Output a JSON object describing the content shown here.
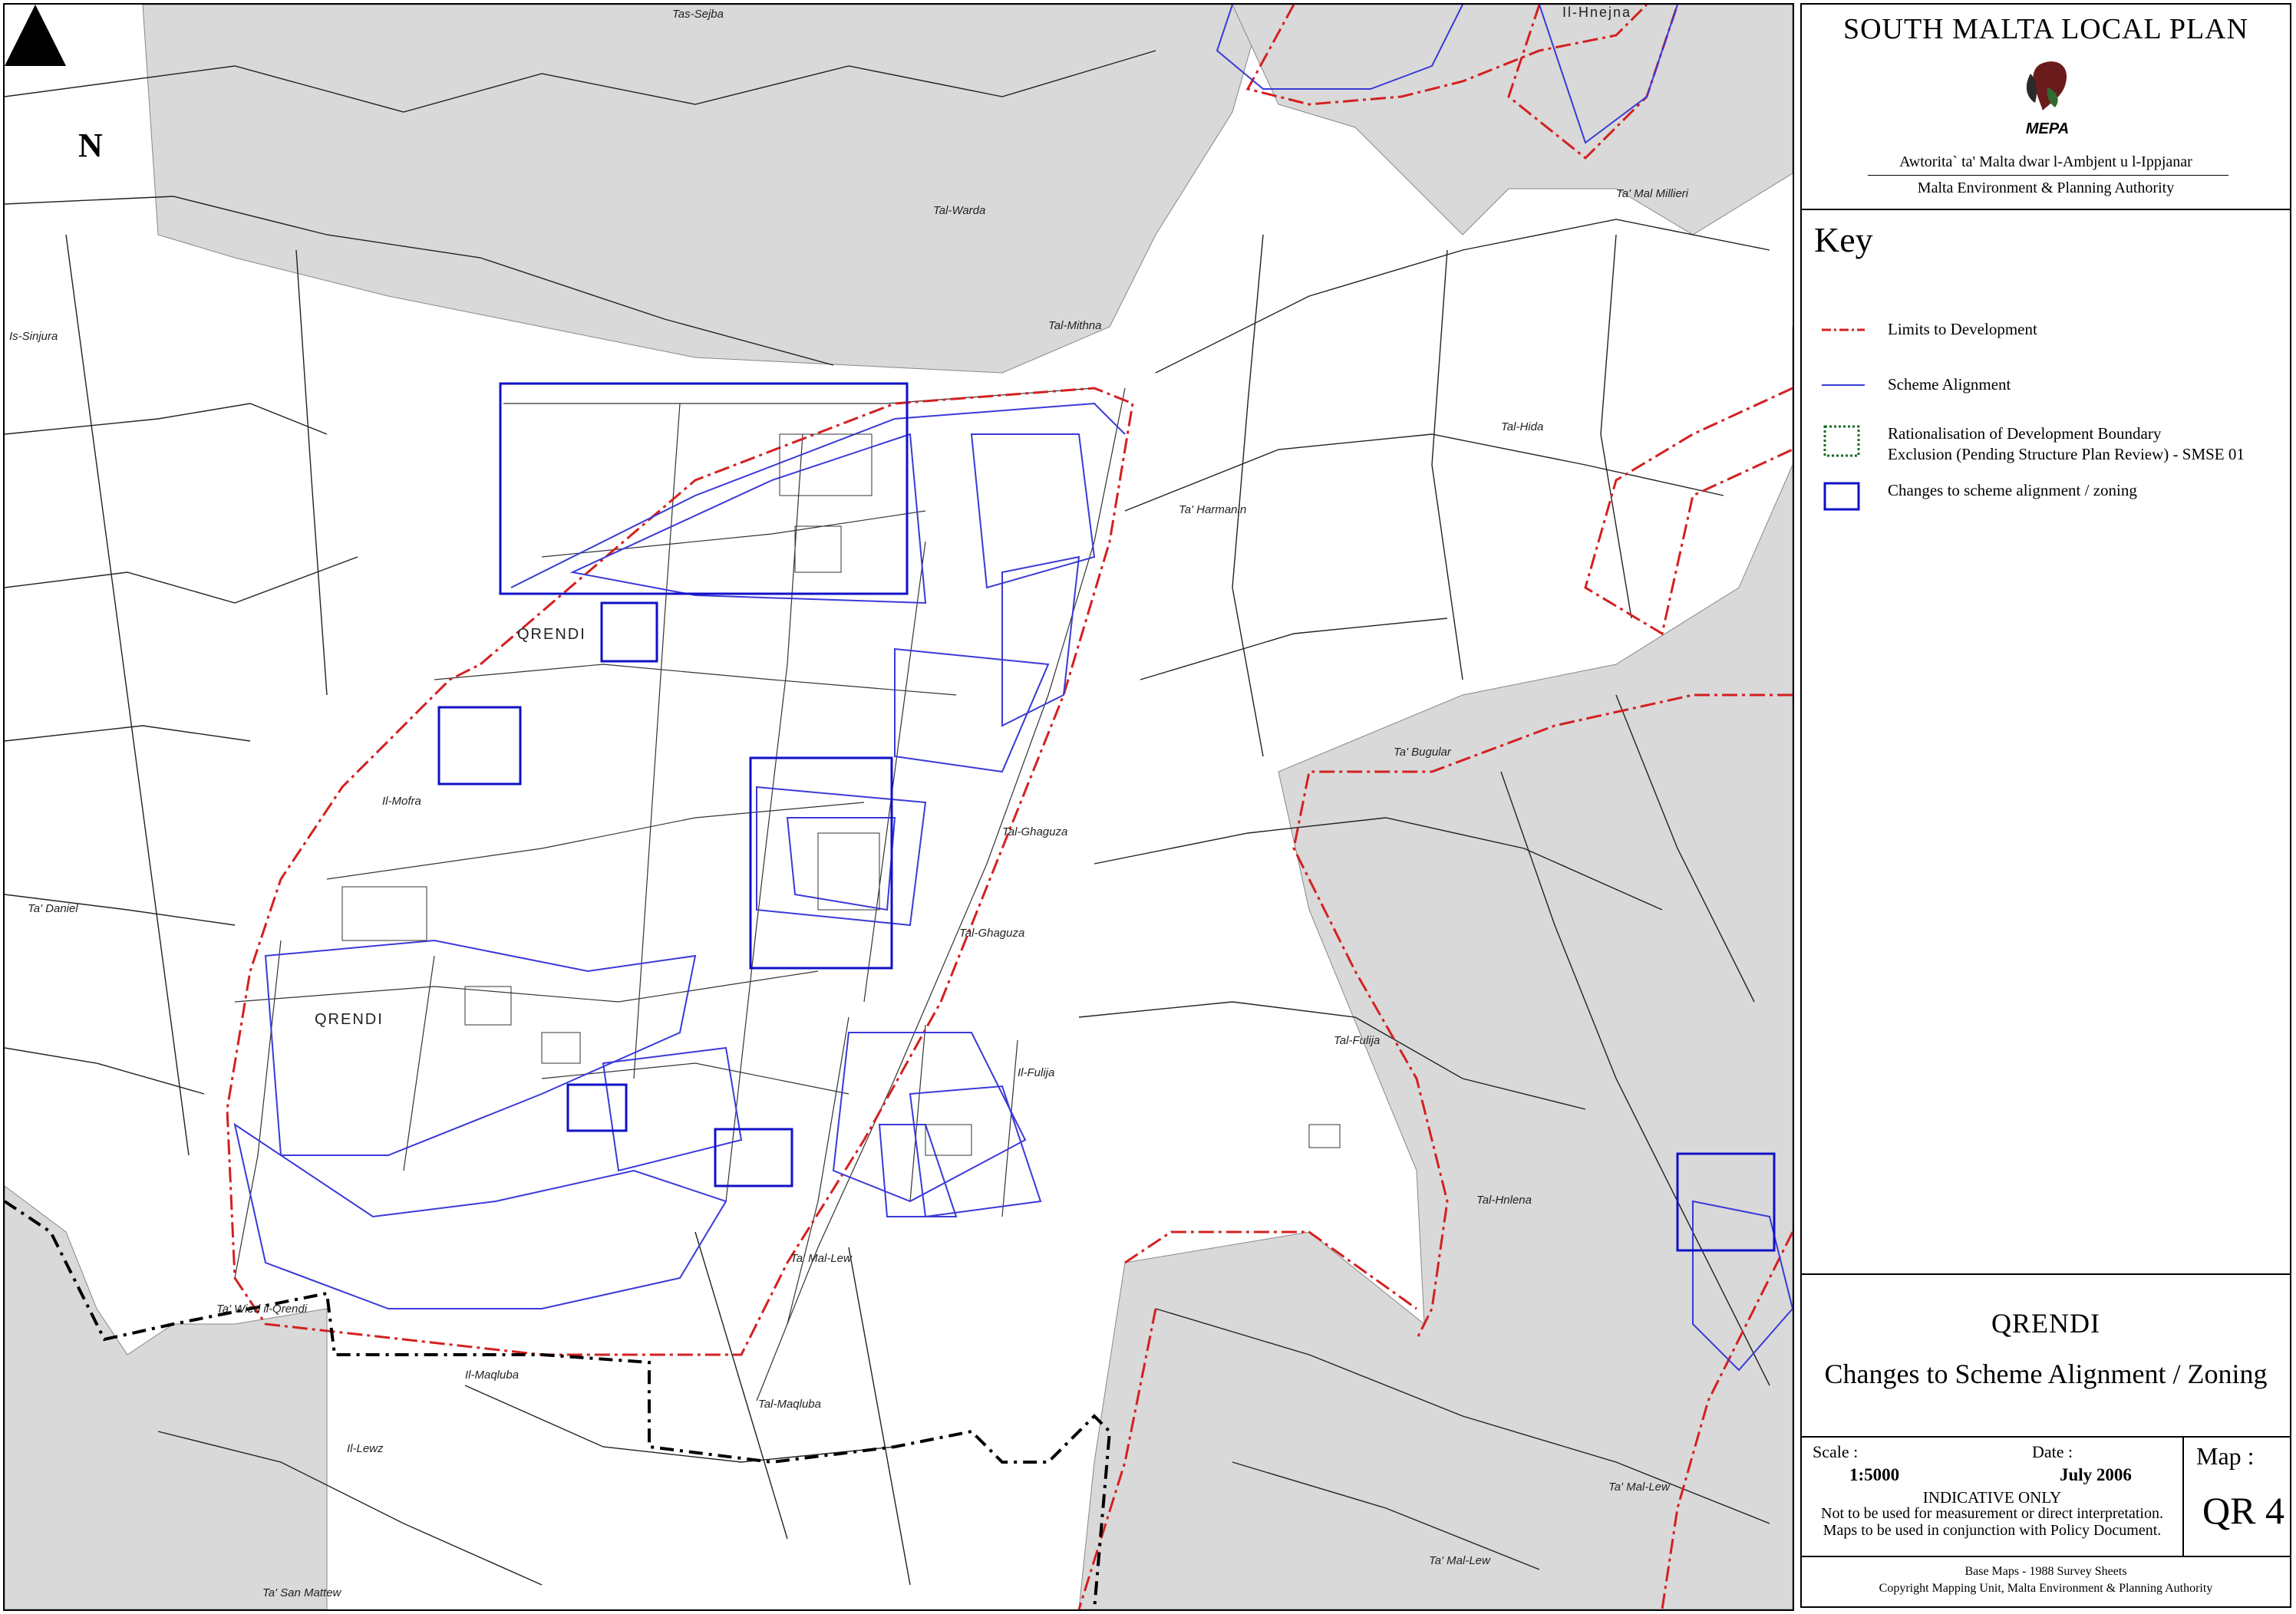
{
  "map": {
    "north_label": "N",
    "place_names": [
      {
        "text": "Tas-Sejba"
      },
      {
        "text": "Il-Hnejna"
      },
      {
        "text": "Is-Sinjura"
      },
      {
        "text": "Tal-Warda"
      },
      {
        "text": "Tal-Mithna"
      },
      {
        "text": "Ta' Mal Millieri"
      },
      {
        "text": "Tal-Hida"
      },
      {
        "text": "Ta' Harmanin"
      },
      {
        "text": "QRENDI"
      },
      {
        "text": "Ta' Bugular"
      },
      {
        "text": "Il-Mofra"
      },
      {
        "text": "Tal-Ghaguza"
      },
      {
        "text": "Tal-Ghaguza"
      },
      {
        "text": "Ta' Daniel"
      },
      {
        "text": "QRENDI"
      },
      {
        "text": "Il-Fulija"
      },
      {
        "text": "Tal-Fulija"
      },
      {
        "text": "Tal-Hnlena"
      },
      {
        "text": "Ta' Mal-Lew"
      },
      {
        "text": "Ta' Wied il-Qrendi"
      },
      {
        "text": "Il-Maqluba"
      },
      {
        "text": "Tal-Maqluba"
      },
      {
        "text": "Il-Lewz"
      },
      {
        "text": "Ta' Mal-Lew"
      },
      {
        "text": "Ta' Mal-Lew"
      },
      {
        "text": "Ta' San Mattew"
      }
    ]
  },
  "panel": {
    "plan_title": "SOUTH MALTA LOCAL PLAN",
    "logo_text": "MEPA",
    "authority_maltese": "Awtorita` ta' Malta dwar l-Ambjent u l-Ippjanar",
    "authority_english": "Malta Environment & Planning Authority",
    "key_heading": "Key",
    "key_items": [
      {
        "label_line1": "Limits to Development",
        "label_line2": "",
        "symbol": "red-dash-dot-line",
        "color": "#d42020"
      },
      {
        "label_line1": "Scheme Alignment",
        "label_line2": "",
        "symbol": "blue-line",
        "color": "#3a3ad8"
      },
      {
        "label_line1": "Rationalisation of Development Boundary",
        "label_line2": "Exclusion (Pending Structure Plan Review) - SMSE 01",
        "symbol": "green-dotted-box",
        "color": "#1a6a2a"
      },
      {
        "label_line1": "Changes to scheme alignment / zoning",
        "label_line2": "",
        "symbol": "blue-box",
        "color": "#1010c8"
      }
    ],
    "map_locality": "QRENDI",
    "map_subject": "Changes to Scheme Alignment / Zoning",
    "scale_label": "Scale :",
    "scale_value": "1:5000",
    "date_label": "Date :",
    "date_value": "July 2006",
    "indicative": "INDICATIVE ONLY",
    "disclaimer_1": "Not to be used for measurement or direct interpretation.",
    "disclaimer_2": "Maps to be used in conjunction with Policy Document.",
    "map_label": "Map :",
    "map_number": "QR 4",
    "credits_1": "Base Maps - 1988 Survey Sheets",
    "credits_2": "Copyright Mapping Unit, Malta Environment & Planning Authority"
  },
  "colors": {
    "limits_to_development": "#d42020",
    "scheme_alignment": "#3a3ad8",
    "change_box": "#1010c8",
    "outside_area_fill": "#d9d9d9",
    "external_boundary": "#000000"
  }
}
